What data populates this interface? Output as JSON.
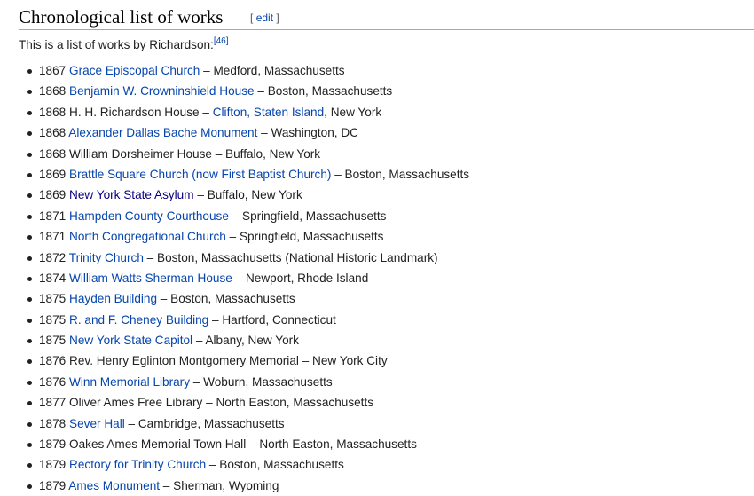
{
  "section": {
    "title": "Chronological list of works",
    "edit_label": "edit",
    "edit_open": "[",
    "edit_close": "]"
  },
  "intro": {
    "text": "This is a list of works by Richardson:",
    "citation": "[46]"
  },
  "colors": {
    "link": "#0645ad",
    "visited_link": "#0b0080",
    "text": "#202122",
    "heading_rule": "#a2a9b1"
  },
  "works": [
    {
      "year": "1867",
      "segments": [
        {
          "text": "Grace Episcopal Church",
          "link": true
        },
        {
          "text": " – Medford, Massachusetts",
          "link": false
        }
      ]
    },
    {
      "year": "1868",
      "segments": [
        {
          "text": "Benjamin W. Crowninshield House",
          "link": true
        },
        {
          "text": " – Boston, Massachusetts",
          "link": false
        }
      ]
    },
    {
      "year": "1868",
      "segments": [
        {
          "text": "H. H. Richardson House – ",
          "link": false
        },
        {
          "text": "Clifton, Staten Island",
          "link": true
        },
        {
          "text": ", New York",
          "link": false
        }
      ]
    },
    {
      "year": "1868",
      "segments": [
        {
          "text": "Alexander Dallas Bache Monument",
          "link": true
        },
        {
          "text": " – Washington, DC",
          "link": false
        }
      ]
    },
    {
      "year": "1868",
      "segments": [
        {
          "text": "William Dorsheimer House – Buffalo, New York",
          "link": false
        }
      ]
    },
    {
      "year": "1869",
      "segments": [
        {
          "text": "Brattle Square Church (now First Baptist Church)",
          "link": true
        },
        {
          "text": " – Boston, Massachusetts",
          "link": false
        }
      ]
    },
    {
      "year": "1869",
      "segments": [
        {
          "text": "New York State Asylum",
          "link": true,
          "visited": true
        },
        {
          "text": " – Buffalo, New York",
          "link": false
        }
      ]
    },
    {
      "year": "1871",
      "segments": [
        {
          "text": "Hampden County Courthouse",
          "link": true
        },
        {
          "text": " – Springfield, Massachusetts",
          "link": false
        }
      ]
    },
    {
      "year": "1871",
      "segments": [
        {
          "text": "North Congregational Church",
          "link": true
        },
        {
          "text": " – Springfield, Massachusetts",
          "link": false
        }
      ]
    },
    {
      "year": "1872",
      "segments": [
        {
          "text": "Trinity Church",
          "link": true
        },
        {
          "text": " – Boston, Massachusetts (National Historic Landmark)",
          "link": false
        }
      ]
    },
    {
      "year": "1874",
      "segments": [
        {
          "text": "William Watts Sherman House",
          "link": true
        },
        {
          "text": " – Newport, Rhode Island",
          "link": false
        }
      ]
    },
    {
      "year": "1875",
      "segments": [
        {
          "text": "Hayden Building",
          "link": true
        },
        {
          "text": " – Boston, Massachusetts",
          "link": false
        }
      ]
    },
    {
      "year": "1875",
      "segments": [
        {
          "text": "R. and F. Cheney Building",
          "link": true
        },
        {
          "text": " – Hartford, Connecticut",
          "link": false
        }
      ]
    },
    {
      "year": "1875",
      "segments": [
        {
          "text": "New York State Capitol",
          "link": true
        },
        {
          "text": " – Albany, New York",
          "link": false
        }
      ]
    },
    {
      "year": "1876",
      "segments": [
        {
          "text": "Rev. Henry Eglinton Montgomery Memorial – New York City",
          "link": false
        }
      ]
    },
    {
      "year": "1876",
      "segments": [
        {
          "text": "Winn Memorial Library",
          "link": true
        },
        {
          "text": " – Woburn, Massachusetts",
          "link": false
        }
      ]
    },
    {
      "year": "1877",
      "segments": [
        {
          "text": "Oliver Ames Free Library – North Easton, Massachusetts",
          "link": false
        }
      ]
    },
    {
      "year": "1878",
      "segments": [
        {
          "text": "Sever Hall",
          "link": true
        },
        {
          "text": " – Cambridge, Massachusetts",
          "link": false
        }
      ]
    },
    {
      "year": "1879",
      "segments": [
        {
          "text": "Oakes Ames Memorial Town Hall – North Easton, Massachusetts",
          "link": false
        }
      ]
    },
    {
      "year": "1879",
      "segments": [
        {
          "text": "Rectory for Trinity Church",
          "link": true
        },
        {
          "text": " – Boston, Massachusetts",
          "link": false
        }
      ]
    },
    {
      "year": "1879",
      "segments": [
        {
          "text": "Ames Monument",
          "link": true
        },
        {
          "text": " – Sherman, Wyoming",
          "link": false
        }
      ]
    }
  ]
}
